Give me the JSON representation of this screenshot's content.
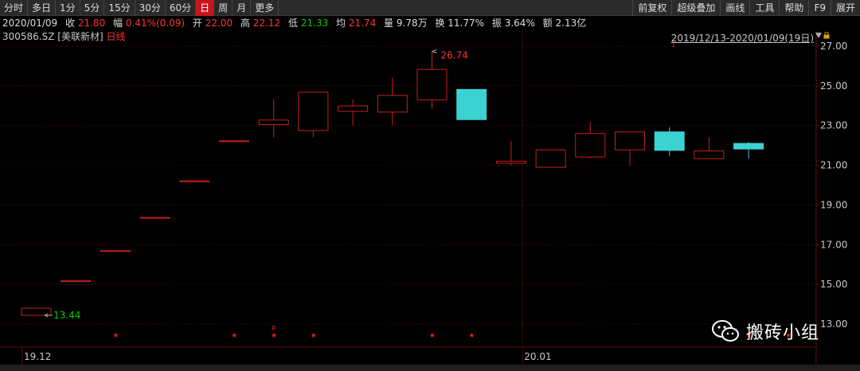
{
  "toolbar": {
    "period_tabs": [
      "分时",
      "多日",
      "1分",
      "5分",
      "15分",
      "30分",
      "60分",
      "日",
      "周",
      "月",
      "更多"
    ],
    "active_tab": "日",
    "right_tools": [
      "前复权",
      "超级叠加",
      "画线",
      "工具",
      "帮助",
      "F9",
      "展开"
    ]
  },
  "infobar": {
    "date": "2020/01/09",
    "close_label": "收",
    "close": "21.80",
    "change_label": "幅",
    "change": "0.41%(0.09)",
    "open_label": "开",
    "open": "22.00",
    "high_label": "高",
    "high": "22.12",
    "low_label": "低",
    "low": "21.33",
    "avg_label": "均",
    "avg": "21.74",
    "volume_label": "量",
    "volume": "9.78万",
    "turnover_label": "换",
    "turnover": "11.77%",
    "amplitude_label": "振",
    "amplitude": "3.64%",
    "amount_label": "额",
    "amount": "2.13亿"
  },
  "stock": {
    "code": "300586.SZ",
    "name": "[美联新材]",
    "period": "日线"
  },
  "range_label": "2019/12/13-2020/01/09(19日)",
  "colors": {
    "up": "#c81e1e",
    "down": "#3cd2d2",
    "grid": "#3a0a0a",
    "axis_text": "#c8c8c8",
    "max_label": "#ff3232",
    "min_label": "#00c800"
  },
  "chart_data": {
    "type": "candlestick",
    "y_ticks": [
      "27.00",
      "25.00",
      "23.00",
      "21.00",
      "19.00",
      "17.00",
      "15.00",
      "13.00"
    ],
    "x_labels": [
      {
        "text": "19.12",
        "index": 0
      },
      {
        "text": "20.01",
        "index": 13
      }
    ],
    "ylim": [
      13.0,
      27.0
    ],
    "candles": [
      {
        "o": 13.44,
        "h": 13.8,
        "l": 13.44,
        "c": 13.8
      },
      {
        "o": 15.18,
        "h": 15.18,
        "l": 15.18,
        "c": 15.18
      },
      {
        "o": 16.7,
        "h": 16.7,
        "l": 16.7,
        "c": 16.7
      },
      {
        "o": 18.37,
        "h": 18.37,
        "l": 18.37,
        "c": 18.37
      },
      {
        "o": 20.21,
        "h": 20.21,
        "l": 20.21,
        "c": 20.21
      },
      {
        "o": 22.23,
        "h": 22.23,
        "l": 22.23,
        "c": 22.23
      },
      {
        "o": 23.05,
        "h": 24.35,
        "l": 22.4,
        "c": 23.28
      },
      {
        "o": 22.75,
        "h": 24.7,
        "l": 22.4,
        "c": 24.68
      },
      {
        "o": 23.72,
        "h": 24.32,
        "l": 22.98,
        "c": 23.99
      },
      {
        "o": 23.68,
        "h": 25.4,
        "l": 22.98,
        "c": 24.52
      },
      {
        "o": 24.3,
        "h": 26.74,
        "l": 23.85,
        "c": 25.83
      },
      {
        "o": 24.82,
        "h": 24.82,
        "l": 23.3,
        "c": 23.3
      },
      {
        "o": 21.1,
        "h": 22.22,
        "l": 21.0,
        "c": 21.2
      },
      {
        "o": 20.9,
        "h": 21.78,
        "l": 20.9,
        "c": 21.78
      },
      {
        "o": 21.42,
        "h": 23.18,
        "l": 21.35,
        "c": 22.6
      },
      {
        "o": 21.78,
        "h": 22.72,
        "l": 21.0,
        "c": 22.68
      },
      {
        "o": 22.68,
        "h": 22.9,
        "l": 21.48,
        "c": 21.75
      },
      {
        "o": 21.33,
        "h": 22.4,
        "l": 21.33,
        "c": 21.72
      },
      {
        "o": 22.1,
        "h": 22.18,
        "l": 21.33,
        "c": 21.82
      }
    ],
    "annotations": {
      "max_label": "26.74",
      "min_label": "13.44"
    },
    "star_indices": [
      1,
      4,
      5,
      6,
      9,
      10,
      17,
      18
    ],
    "r_marker_index": 5,
    "mark_1_index": 16
  },
  "bottom_tabs": [
    "",
    "",
    "",
    "",
    "",
    "",
    "",
    ""
  ],
  "watermark": {
    "text": "搬砖小组",
    "icon": "wechat-icon"
  }
}
